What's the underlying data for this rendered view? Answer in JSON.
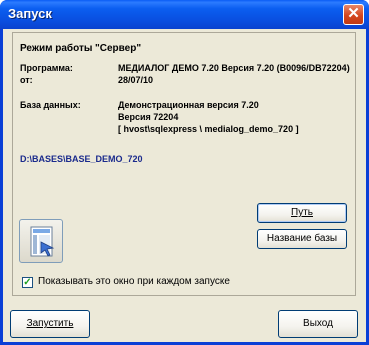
{
  "window": {
    "title": "Запуск",
    "close_glyph": "✕"
  },
  "info": {
    "mode_label": "Режим работы",
    "mode_value": "\"Сервер\"",
    "program_label": "Программа:",
    "program_value": "МЕДИАЛОГ ДЕМО 7.20 Версия 7.20 (В0096/DB72204)",
    "from_label": "от:",
    "from_value": "28/07/10",
    "db_label": "База данных:",
    "db_line1": "Демонстрационная версия 7.20",
    "db_line2": "Версия 72204",
    "db_line3": "[ hvost\\sqlexpress \\ medialog_demo_720 ]",
    "path": "D:\\BASES\\BASE_DEMO_720"
  },
  "buttons": {
    "path": "Путь",
    "db_name": "Название базы",
    "launch": "Запустить",
    "exit": "Выход"
  },
  "checkbox": {
    "label": "Показывать это окно при каждом запуске",
    "checked": true
  },
  "icons": {
    "close": "close-icon",
    "db_app": "database-app-icon",
    "check": "checkmark-icon"
  }
}
